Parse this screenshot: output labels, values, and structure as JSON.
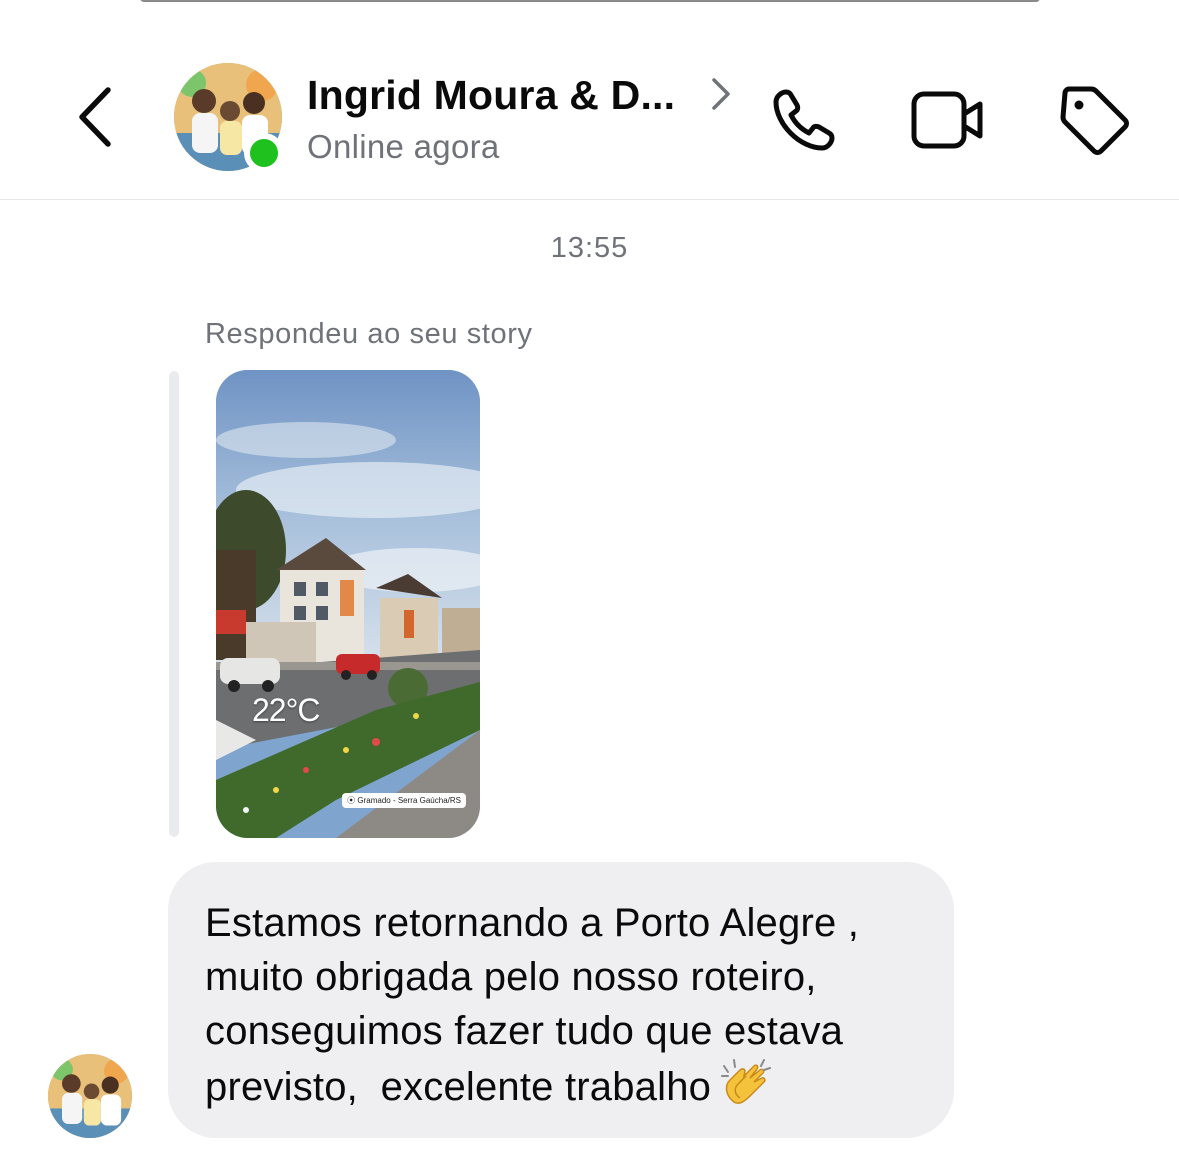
{
  "header": {
    "contact_name": "Ingrid Moura & D...",
    "status": "Online agora",
    "icons": {
      "back": "chevron-left-icon",
      "profile_link": "chevron-right-icon",
      "call": "phone-icon",
      "video": "video-camera-icon",
      "label": "tag-icon"
    }
  },
  "conversation": {
    "timestamp": "13:55",
    "reply_label": "Respondeu ao seu story",
    "story": {
      "temperature": "22°C",
      "location": "Gramado - Serra Gaúcha/RS"
    },
    "message": {
      "text": "Estamos retornando a Porto Alegre ,\nmuito obrigada pelo nosso roteiro,\nconseguimos fazer tudo que estava\nprevisto,  excelente trabalho",
      "emoji": "clapping-hands-emoji"
    }
  },
  "colors": {
    "online": "#1fc11f",
    "bubble": "#efeff1",
    "secondary_text": "#6f7379"
  }
}
